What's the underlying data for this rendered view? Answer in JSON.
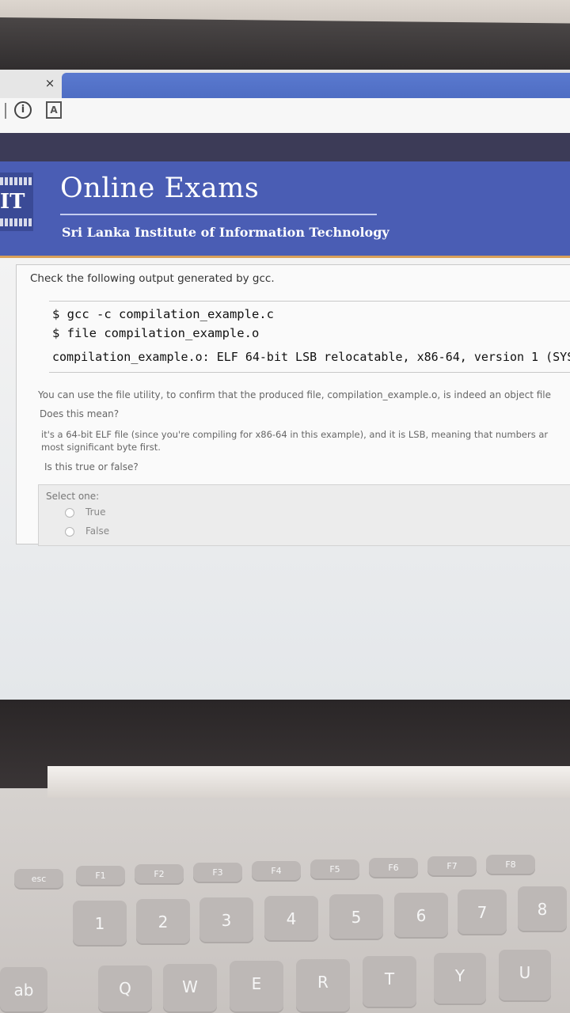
{
  "browser": {
    "tab_close": "×",
    "info_icon": "i",
    "page_icon": "A"
  },
  "header": {
    "logo_text": "IT",
    "title": "Online Exams",
    "institute": "Sri Lanka Institute of Information Technology"
  },
  "question": {
    "lead": "Check the following output generated by gcc.",
    "code": [
      "$ gcc -c compilation_example.c",
      "$ file compilation_example.o",
      "compilation_example.o: ELF 64-bit LSB relocatable, x86-64, version 1 (SYS"
    ],
    "explain": "You can use the file utility, to confirm that the produced file, compilation_example.o, is indeed an object file",
    "mean": "Does this mean?",
    "statement_line1": "it's a 64-bit ELF file (since you're compiling for x86-64 in this example), and it is LSB, meaning that numbers ar",
    "statement_line2": "most significant byte first.",
    "ask": "Is this true or false?",
    "select_label": "Select one:",
    "options": [
      "True",
      "False"
    ]
  },
  "keyboard": {
    "fkeys": [
      "esc",
      "F1",
      "F2",
      "F3",
      "F4",
      "F5",
      "F6",
      "F7",
      "F8"
    ],
    "numkeys": [
      "1",
      "2",
      "3",
      "4",
      "5",
      "6",
      "7",
      "8"
    ],
    "letters": [
      "Q",
      "W",
      "E",
      "R",
      "T",
      "Y",
      "U"
    ],
    "tab": "ab"
  }
}
